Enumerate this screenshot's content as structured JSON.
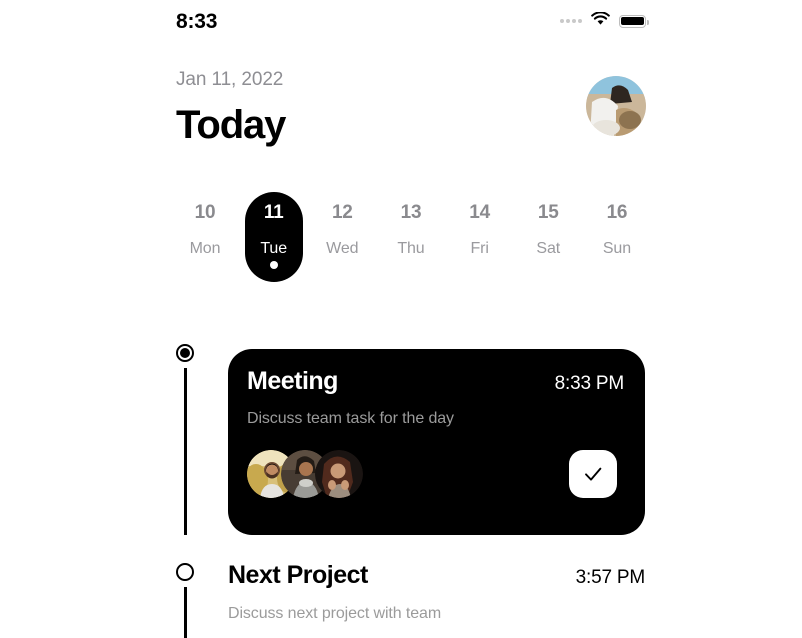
{
  "status_bar": {
    "time": "8:33",
    "signal_icon": "signal-dots-icon",
    "wifi_icon": "wifi-icon",
    "battery_icon": "battery-full-icon"
  },
  "header": {
    "date": "Jan 11, 2022",
    "title": "Today",
    "avatar_alt": "user-profile-photo"
  },
  "week_strip": {
    "days": [
      {
        "num": "10",
        "name": "Mon",
        "selected": false
      },
      {
        "num": "11",
        "name": "Tue",
        "selected": true
      },
      {
        "num": "12",
        "name": "Wed",
        "selected": false
      },
      {
        "num": "13",
        "name": "Thu",
        "selected": false
      },
      {
        "num": "14",
        "name": "Fri",
        "selected": false
      },
      {
        "num": "15",
        "name": "Sat",
        "selected": false
      },
      {
        "num": "16",
        "name": "Sun",
        "selected": false
      }
    ]
  },
  "events": [
    {
      "title": "Meeting",
      "time": "8:33 PM",
      "subtitle": "Discuss team task for the day",
      "highlighted": true,
      "attendee_count": 3,
      "action_icon": "check-icon"
    },
    {
      "title": "Next Project",
      "time": "3:57 PM",
      "subtitle": "Discuss next project with team",
      "highlighted": false
    }
  ],
  "colors": {
    "background": "#ffffff",
    "accent": "#000000",
    "muted_text": "#8e8e93",
    "card_text": "#ffffff",
    "card_subtext": "#9b9b9b"
  }
}
